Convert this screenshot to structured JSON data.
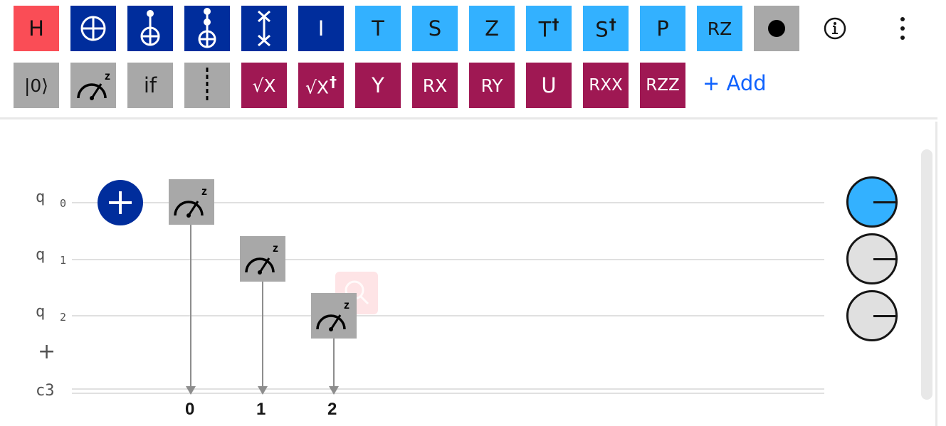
{
  "toolbar": {
    "row1": [
      {
        "label": "H",
        "icon": "h-gate",
        "color": "#fa4d56"
      },
      {
        "label": "",
        "icon": "not-gate-icon",
        "color": "#002d9c"
      },
      {
        "label": "",
        "icon": "cnot-gate-icon",
        "color": "#002d9c"
      },
      {
        "label": "",
        "icon": "toffoli-gate-icon",
        "color": "#002d9c"
      },
      {
        "label": "",
        "icon": "swap-gate-icon",
        "color": "#002d9c"
      },
      {
        "label": "I",
        "icon": "identity-gate",
        "color": "#002d9c"
      },
      {
        "label": "T",
        "icon": "t-gate",
        "color": "#33b1ff"
      },
      {
        "label": "S",
        "icon": "s-gate",
        "color": "#33b1ff"
      },
      {
        "label": "Z",
        "icon": "z-gate",
        "color": "#33b1ff"
      },
      {
        "label": "T",
        "suffix": "†",
        "icon": "tdg-gate",
        "color": "#33b1ff"
      },
      {
        "label": "S",
        "suffix": "†",
        "icon": "sdg-gate",
        "color": "#33b1ff"
      },
      {
        "label": "P",
        "icon": "phase-gate",
        "color": "#33b1ff"
      },
      {
        "label": "RZ",
        "icon": "rz-gate",
        "color": "#33b1ff"
      },
      {
        "label": "",
        "icon": "control-dot-icon",
        "color": "#a8a8a8"
      }
    ],
    "row2": [
      {
        "label": "|0⟩",
        "icon": "reset-gate",
        "color": "#a8a8a8"
      },
      {
        "label": "",
        "icon": "measure-icon",
        "color": "#a8a8a8"
      },
      {
        "label": "if",
        "icon": "if-gate",
        "color": "#a8a8a8"
      },
      {
        "label": "",
        "icon": "barrier-icon",
        "color": "#a8a8a8"
      },
      {
        "label": "√X",
        "icon": "sx-gate",
        "color": "#9f1853"
      },
      {
        "label": "√X",
        "suffix": "†",
        "icon": "sxdg-gate",
        "color": "#9f1853"
      },
      {
        "label": "Y",
        "icon": "y-gate",
        "color": "#9f1853"
      },
      {
        "label": "RX",
        "icon": "rx-gate",
        "color": "#9f1853"
      },
      {
        "label": "RY",
        "icon": "ry-gate",
        "color": "#9f1853"
      },
      {
        "label": "U",
        "icon": "u-gate",
        "color": "#9f1853"
      },
      {
        "label": "RXX",
        "icon": "rxx-gate",
        "color": "#9f1853"
      },
      {
        "label": "RZZ",
        "icon": "rzz-gate",
        "color": "#9f1853"
      }
    ],
    "add_label": "+ Add",
    "info_icon": "info-icon",
    "more_icon": "overflow-menu-icon"
  },
  "circuit": {
    "qubits": [
      {
        "name": "q",
        "index": "0"
      },
      {
        "name": "q",
        "index": "1"
      },
      {
        "name": "q",
        "index": "2"
      }
    ],
    "add_qubit_label": "+",
    "classical_register": "c3",
    "bit_labels": [
      "0",
      "1",
      "2"
    ],
    "probe_colors": [
      "#33b1ff",
      "#e0e0e0",
      "#e0e0e0"
    ]
  }
}
